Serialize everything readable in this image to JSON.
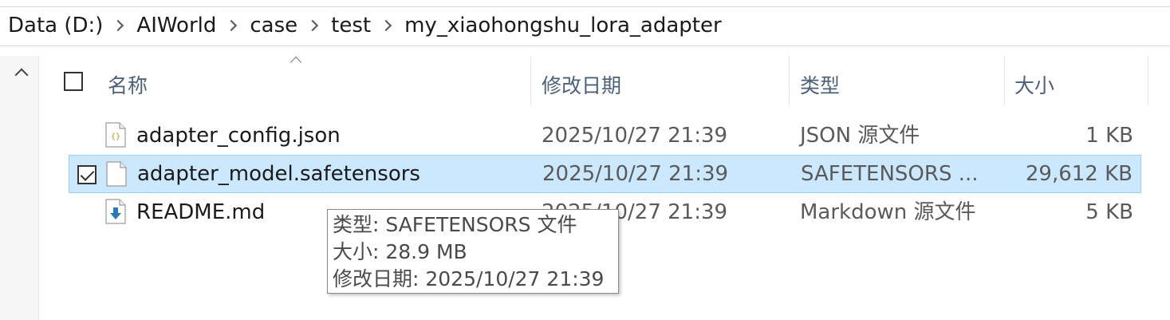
{
  "breadcrumb": [
    "Data (D:)",
    "AIWorld",
    "case",
    "test",
    "my_xiaohongshu_lora_adapter"
  ],
  "columns": {
    "name": "名称",
    "modified": "修改日期",
    "type": "类型",
    "size": "大小"
  },
  "files": [
    {
      "name": "adapter_config.json",
      "modified": "2025/10/27 21:39",
      "type": "JSON 源文件",
      "size": "1 KB",
      "icon": "json-file-icon",
      "selected": false
    },
    {
      "name": "adapter_model.safetensors",
      "modified": "2025/10/27 21:39",
      "type": "SAFETENSORS ...",
      "size": "29,612 KB",
      "icon": "generic-file-icon",
      "selected": true
    },
    {
      "name": "README.md",
      "modified": "2025/10/27 21:39",
      "type": "Markdown 源文件",
      "size": "5 KB",
      "icon": "markdown-file-icon",
      "selected": false
    }
  ],
  "tooltip": {
    "type": "类型: SAFETENSORS 文件",
    "size": "大小: 28.9 MB",
    "modified": "修改日期: 2025/10/27 21:39"
  },
  "colors": {
    "selection_bg": "#cce8ff",
    "selection_border": "#99d1ff",
    "header_text": "#4c607a"
  }
}
